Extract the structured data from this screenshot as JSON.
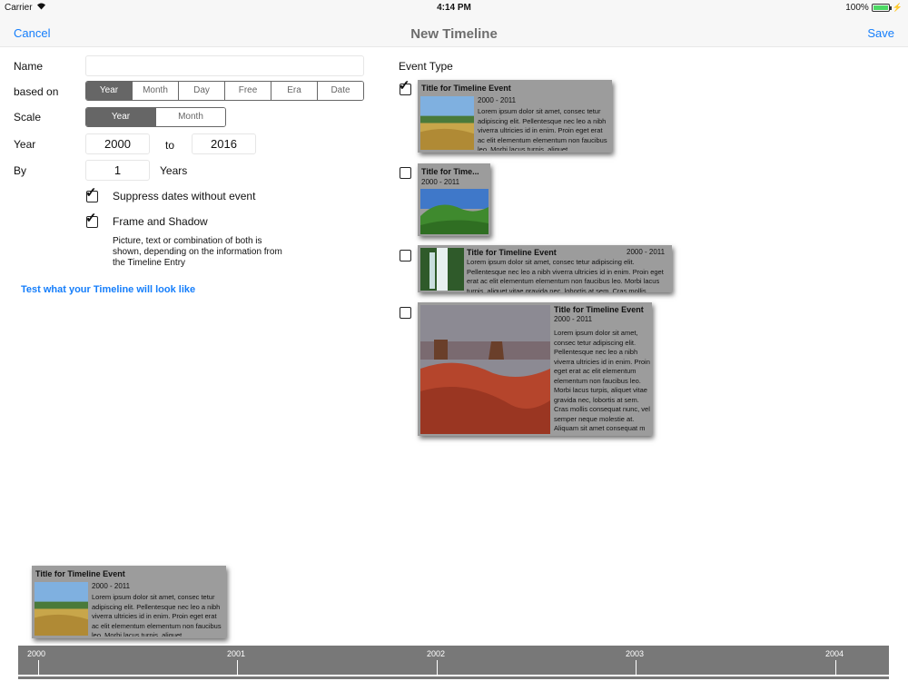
{
  "status_bar": {
    "carrier": "Carrier",
    "time": "4:14 PM",
    "battery": "100%",
    "battery_level": 1.0
  },
  "nav": {
    "cancel": "Cancel",
    "title": "New Timeline",
    "save": "Save"
  },
  "form": {
    "name_label": "Name",
    "name_value": "",
    "based_on_label": "based on",
    "based_on_options": [
      "Year",
      "Month",
      "Day",
      "Free",
      "Era",
      "Date"
    ],
    "based_on_selected": "Year",
    "scale_label": "Scale",
    "scale_options": [
      "Year",
      "Month"
    ],
    "scale_selected": "Year",
    "year_label": "Year",
    "year_from": "2000",
    "to_label": "to",
    "year_to": "2016",
    "by_label": "By",
    "by_value": "1",
    "by_unit": "Years",
    "suppress_label": "Suppress dates without event",
    "suppress_checked": true,
    "frame_label": "Frame and Shadow",
    "frame_checked": true,
    "frame_note": "Picture, text  or combination of both is shown, depending on the information from the Timeline Entry",
    "test_link": "Test what your Timeline will look like"
  },
  "event_type": {
    "label": "Event Type",
    "options": [
      {
        "checked": true,
        "title": "Title for Timeline Event",
        "date": "2000 - 2011",
        "body": "Lorem ipsum dolor sit amet, consec tetur adipiscing elit. Pellentesque nec leo a nibh viverra ultricies id in enim. Proin eget erat ac elit elementum elementum non faucibus leo. Morbi lacus turpis, aliquet"
      },
      {
        "checked": false,
        "title": "Title for Time...",
        "date": "2000 - 2011"
      },
      {
        "checked": false,
        "title": "Title for Timeline Event",
        "date": "2000 - 2011",
        "body": "Lorem ipsum dolor sit amet, consec tetur adipiscing elit. Pellentesque nec leo a nibh viverra ultricies id in enim. Proin eget erat ac elit elementum elementum non faucibus leo. Morbi lacus turpis, aliquet vitae gravida nec, lobortis at sem. Cras mollis"
      },
      {
        "checked": false,
        "title": "Title for Timeline Event",
        "date": "2000 - 2011",
        "body": "Lorem ipsum dolor sit amet, consec tetur adipiscing elit. Pellentesque nec leo a nibh viverra ultricies id in enim. Proin eget erat ac elit elementum elementum non faucibus leo. Morbi lacus turpis, aliquet vitae gravida nec, lobortis at sem. Cras mollis consequat nunc, vel semper neque molestie at. Aliquam sit amet consequat m"
      }
    ]
  },
  "preview_card": {
    "title": "Title for Timeline Event",
    "date": "2000 - 2011",
    "body": "Lorem ipsum dolor sit amet, consec tetur adipiscing elit. Pellentesque nec leo a nibh viverra ultricies id in enim. Proin eget erat ac elit elementum elementum non faucibus leo. Morbi lacus turpis, aliquet"
  },
  "timeline_axis": {
    "ticks": [
      "2000",
      "2001",
      "2002",
      "2003",
      "2004"
    ]
  },
  "colors": {
    "accent": "#157efb",
    "card_bg": "#9c9c9c",
    "axis_bg": "#787878",
    "segment_selected": "#666666"
  }
}
